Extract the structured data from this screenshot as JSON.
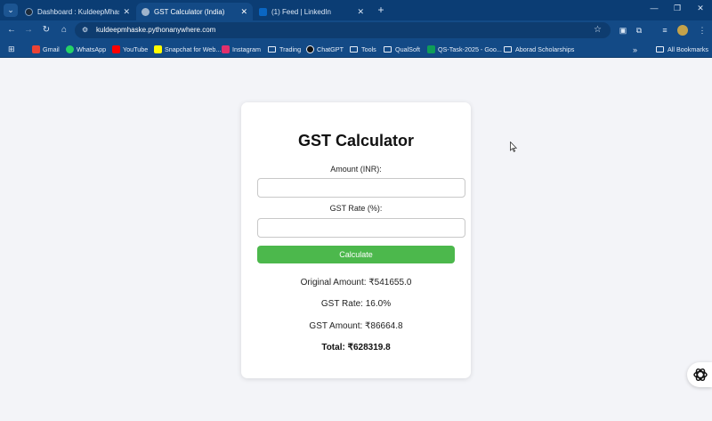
{
  "browser": {
    "tabs": [
      {
        "title": "Dashboard : KuldeepMhaske : P",
        "favicon_color": "#1d2b3a",
        "close": "✕"
      },
      {
        "title": "GST Calculator (India)",
        "favicon_color": "#9fb4cc",
        "close": "✕"
      },
      {
        "title": "(1) Feed | LinkedIn",
        "favicon_color": "#0a66c2",
        "close": "✕"
      }
    ],
    "new_tab": "+",
    "window_controls": {
      "minimize": "—",
      "restore": "❐",
      "close": "✕"
    },
    "address": "kuldeepmhaske.pythonanywhere.com",
    "bookmarks": [
      {
        "label": "Gmail",
        "icon": "gmail-icon",
        "color": "#ea4335"
      },
      {
        "label": "WhatsApp",
        "icon": "whatsapp-icon",
        "color": "#25d366"
      },
      {
        "label": "YouTube",
        "icon": "youtube-icon",
        "color": "#ff0000"
      },
      {
        "label": "Snapchat for Web...",
        "icon": "snapchat-icon",
        "color": "#fffc00"
      },
      {
        "label": "Instagram",
        "icon": "instagram-icon",
        "color": "#e1306c"
      },
      {
        "label": "Trading",
        "icon": "folder-icon",
        "color": ""
      },
      {
        "label": "ChatGPT",
        "icon": "chatgpt-icon",
        "color": "#111111"
      },
      {
        "label": "Tools",
        "icon": "folder-icon",
        "color": ""
      },
      {
        "label": "QualSoft",
        "icon": "folder-icon",
        "color": ""
      },
      {
        "label": "QS-Task-2025 - Goo...",
        "icon": "google-sheets-icon",
        "color": "#0f9d58"
      },
      {
        "label": "Aborad Scholarships",
        "icon": "folder-icon",
        "color": ""
      }
    ],
    "more_bookmarks": "»",
    "all_bookmarks": "All Bookmarks"
  },
  "calculator": {
    "title": "GST Calculator",
    "amount_label": "Amount (INR):",
    "amount_value": "",
    "rate_label": "GST Rate (%):",
    "rate_value": "",
    "button_label": "Calculate",
    "original_amount": "Original Amount: ₹541655.0",
    "gst_rate": "GST Rate: 16.0%",
    "gst_amount": "GST Amount: ₹86664.8",
    "total": "Total: ₹628319.8"
  },
  "colors": {
    "chrome": "#134a86",
    "button": "#4cb84c",
    "background": "#f3f4f8"
  }
}
